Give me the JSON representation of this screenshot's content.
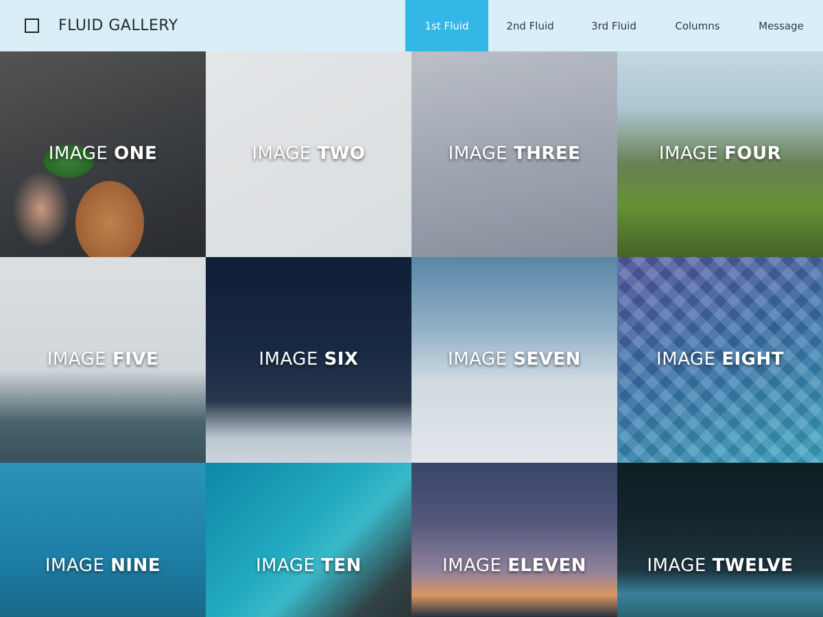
{
  "app": {
    "title": "FLUID GALLERY",
    "icon": "square-icon"
  },
  "nav": {
    "items": [
      {
        "label": "1st Fluid",
        "active": true
      },
      {
        "label": "2nd Fluid",
        "active": false
      },
      {
        "label": "3rd Fluid",
        "active": false
      },
      {
        "label": "Columns",
        "active": false
      },
      {
        "label": "Message",
        "active": false
      }
    ],
    "active_color": "#34b6e6"
  },
  "gallery": {
    "tiles": [
      {
        "prefix": "IMAGE ",
        "word": "ONE"
      },
      {
        "prefix": "IMAGE ",
        "word": "TWO"
      },
      {
        "prefix": "IMAGE ",
        "word": "THREE"
      },
      {
        "prefix": "IMAGE ",
        "word": "FOUR"
      },
      {
        "prefix": "IMAGE ",
        "word": "FIVE"
      },
      {
        "prefix": "IMAGE ",
        "word": "SIX"
      },
      {
        "prefix": "IMAGE ",
        "word": "SEVEN"
      },
      {
        "prefix": "IMAGE ",
        "word": "EIGHT"
      },
      {
        "prefix": "IMAGE ",
        "word": "NINE"
      },
      {
        "prefix": "IMAGE ",
        "word": "TEN"
      },
      {
        "prefix": "IMAGE ",
        "word": "ELEVEN"
      },
      {
        "prefix": "IMAGE ",
        "word": "TWELVE"
      }
    ]
  },
  "colors": {
    "header_bg": "#d9eef7",
    "text_dark": "#1f2a30"
  }
}
